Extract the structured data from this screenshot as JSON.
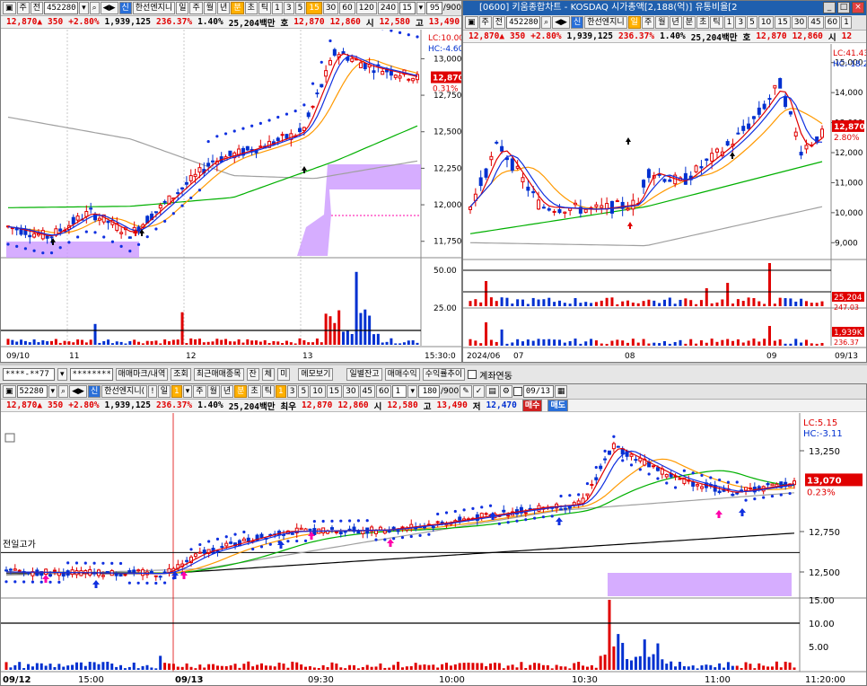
{
  "left_chart": {
    "toolbar": {
      "mode_short": "주",
      "mode_full": "전",
      "code": "452280",
      "stock_name": "한선엔지니",
      "periods": [
        "일",
        "주",
        "월",
        "년",
        "분",
        "초",
        "틱"
      ],
      "period_selected": "분",
      "minutes": [
        "1",
        "3",
        "5",
        "15",
        "30",
        "60",
        "120",
        "240"
      ],
      "minute_selected": "15",
      "interval_value": "15",
      "count": "95",
      "count_total": "/900"
    },
    "quote": {
      "price": "12,870▲",
      "change": "350",
      "pct": "+2.80%",
      "volume": "1,939,125",
      "vol_ratio": "236.37%",
      "turnover_ratio": "1.40%",
      "amount": "25,204백만",
      "bid_label": "호",
      "bid1": "12,870",
      "bid2": "12,860",
      "open_label": "시",
      "open": "12,580",
      "high_label": "고",
      "high": "13,490"
    },
    "lc": "LC:10.00",
    "hc": "HC:-4.60",
    "price_axis": [
      "13,000",
      "12,750",
      "12,500",
      "12,250",
      "12,000",
      "11,750"
    ],
    "price_badge": "12,870",
    "pct_badge": "0.31%",
    "vol_axis": [
      "50.00",
      "25.00"
    ],
    "dates": [
      "09/10",
      "11",
      "12",
      "13"
    ],
    "time_label": "15:30:0"
  },
  "right_chart": {
    "title": "[0600] 키움종합차트 - KOSDAQ 시가총액[2,188(억)] 유통비율[2",
    "toolbar": {
      "mode_short": "주",
      "mode_full": "전",
      "code": "452280",
      "stock_name": "한선엔지니",
      "period_selected": "일",
      "periods": [
        "주",
        "월",
        "년",
        "분",
        "초",
        "틱"
      ],
      "minutes": [
        "1",
        "3",
        "5",
        "10",
        "15",
        "30",
        "45",
        "60",
        "1"
      ]
    },
    "quote": {
      "price": "12,870▲",
      "change": "350",
      "pct": "+2.80%",
      "volume": "1,939,125",
      "vol_ratio": "236.37%",
      "turnover_ratio": "1.40%",
      "amount": "25,204백만",
      "bid_label": "호",
      "bid1": "12,870",
      "bid2": "12,860",
      "open_label": "시",
      "open": "12"
    },
    "lc": "LC:41.43",
    "hc": "HC:-18.2",
    "price_axis": [
      "15,000",
      "14,000",
      "13,000",
      "12,000",
      "11,000",
      "10,000",
      "9,000"
    ],
    "price_badge": "12,870",
    "pct_badge": "2.80%",
    "vol_badge1": "25,204",
    "vol_badge1_sub": "247.03",
    "vol_badge2": "1,939K",
    "vol_badge2_sub": "236.37",
    "dates": [
      "2024/06",
      "07",
      "08",
      "09"
    ],
    "last_date": "09/13"
  },
  "order_bar": {
    "account": "****-**77",
    "password": "********",
    "buttons": [
      "매매마크/내역",
      "조회",
      "최근매매종목",
      "잔",
      "체",
      "미",
      "메모보기",
      "일별잔고",
      "매매수익",
      "수익률추이"
    ],
    "checkbox_label": "계좌연동"
  },
  "bottom_chart": {
    "toolbar": {
      "code": "52280",
      "stock_name": "한선엔지니(",
      "periods": [
        "일",
        "주",
        "월",
        "년",
        "분",
        "초",
        "틱"
      ],
      "period_selected": "분",
      "minutes": [
        "1",
        "3",
        "5",
        "10",
        "15",
        "30",
        "45",
        "60"
      ],
      "minute_selected": "1",
      "interval_value": "1",
      "count": "180",
      "count_total": "/900",
      "date_value": "09/13"
    },
    "quote": {
      "price": "12,870▲",
      "change": "350",
      "pct": "+2.80%",
      "volume": "1,939,125",
      "vol_ratio": "236.37%",
      "turnover_ratio": "1.40%",
      "amount": "25,204백만",
      "best_label": "최우",
      "bid1": "12,870",
      "bid2": "12,860",
      "open_label": "시",
      "open": "12,580",
      "high_label": "고",
      "high": "13,490",
      "low_label": "저",
      "low": "12,470",
      "buy_button": "매수",
      "sell_button": "매도"
    },
    "lc": "LC:5.15",
    "hc": "HC:-3.11",
    "prev_high_label": "전일고가",
    "price_axis": [
      "13,250",
      "12,750",
      "12,500"
    ],
    "price_badge": "13,070",
    "pct_badge": "0.23%",
    "vol_axis": [
      "15.00",
      "10.00",
      "5.00"
    ],
    "times": [
      "09/12",
      "15:00",
      "09/13",
      "09:30",
      "10:00",
      "10:30",
      "11:00"
    ],
    "time_label": "11:20:00"
  },
  "colors": {
    "up": "#e00000",
    "down": "#0030d0",
    "ma5": "#e00000",
    "ma10": "#1030e0",
    "ma20": "#ff9900",
    "ma60": "#00b000",
    "ma120": "#a0a0a0",
    "cloud": "#cc99ff"
  }
}
